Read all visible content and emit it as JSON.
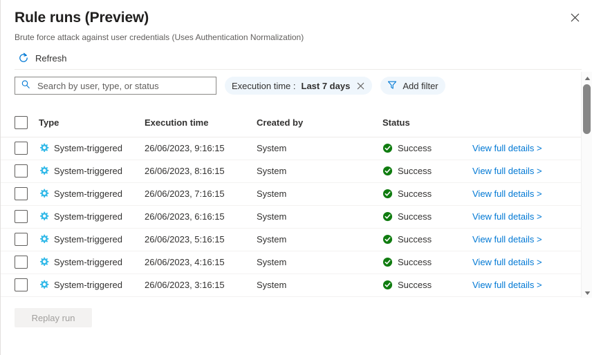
{
  "panel": {
    "title": "Rule runs (Preview)",
    "subtitle": "Brute force attack against user credentials (Uses Authentication Normalization)",
    "close_label": "Close"
  },
  "command_bar": {
    "refresh_label": "Refresh"
  },
  "search": {
    "placeholder": "Search by user, type, or status",
    "value": ""
  },
  "filters": {
    "execution_time": {
      "label": "Execution time :",
      "value": "Last 7 days",
      "remove_label": "Remove filter"
    },
    "add_filter_label": "Add filter"
  },
  "table": {
    "columns": [
      {
        "key": "select",
        "label": ""
      },
      {
        "key": "type",
        "label": "Type"
      },
      {
        "key": "time",
        "label": "Execution time"
      },
      {
        "key": "author",
        "label": "Created by"
      },
      {
        "key": "status",
        "label": "Status"
      },
      {
        "key": "link",
        "label": ""
      }
    ],
    "rows": [
      {
        "type": "System-triggered",
        "time": "26/06/2023, 9:16:15",
        "author": "System",
        "status": "Success",
        "link": "View full details >"
      },
      {
        "type": "System-triggered",
        "time": "26/06/2023, 8:16:15",
        "author": "System",
        "status": "Success",
        "link": "View full details >"
      },
      {
        "type": "System-triggered",
        "time": "26/06/2023, 7:16:15",
        "author": "System",
        "status": "Success",
        "link": "View full details >"
      },
      {
        "type": "System-triggered",
        "time": "26/06/2023, 6:16:15",
        "author": "System",
        "status": "Success",
        "link": "View full details >"
      },
      {
        "type": "System-triggered",
        "time": "26/06/2023, 5:16:15",
        "author": "System",
        "status": "Success",
        "link": "View full details >"
      },
      {
        "type": "System-triggered",
        "time": "26/06/2023, 4:16:15",
        "author": "System",
        "status": "Success",
        "link": "View full details >"
      },
      {
        "type": "System-triggered",
        "time": "26/06/2023, 3:16:15",
        "author": "System",
        "status": "Success",
        "link": "View full details >"
      }
    ]
  },
  "footer": {
    "replay_run_label": "Replay run"
  },
  "colors": {
    "accent": "#0078d4",
    "pill_background": "#eff6fc",
    "success_green": "#107c10",
    "gear_cyan": "#32b9e8",
    "link_blue": "#0078d4",
    "text_primary": "#323130",
    "text_secondary": "#605e5c",
    "disabled_text": "#a19f9d",
    "disabled_background": "#f3f2f1"
  },
  "icons": {
    "close": "close-icon",
    "refresh": "refresh-icon",
    "search": "search-icon",
    "filter": "filter-icon",
    "gear": "gear-icon",
    "success": "success-check-icon",
    "scroll_up": "chevron-up-icon",
    "scroll_down": "chevron-down-icon"
  }
}
